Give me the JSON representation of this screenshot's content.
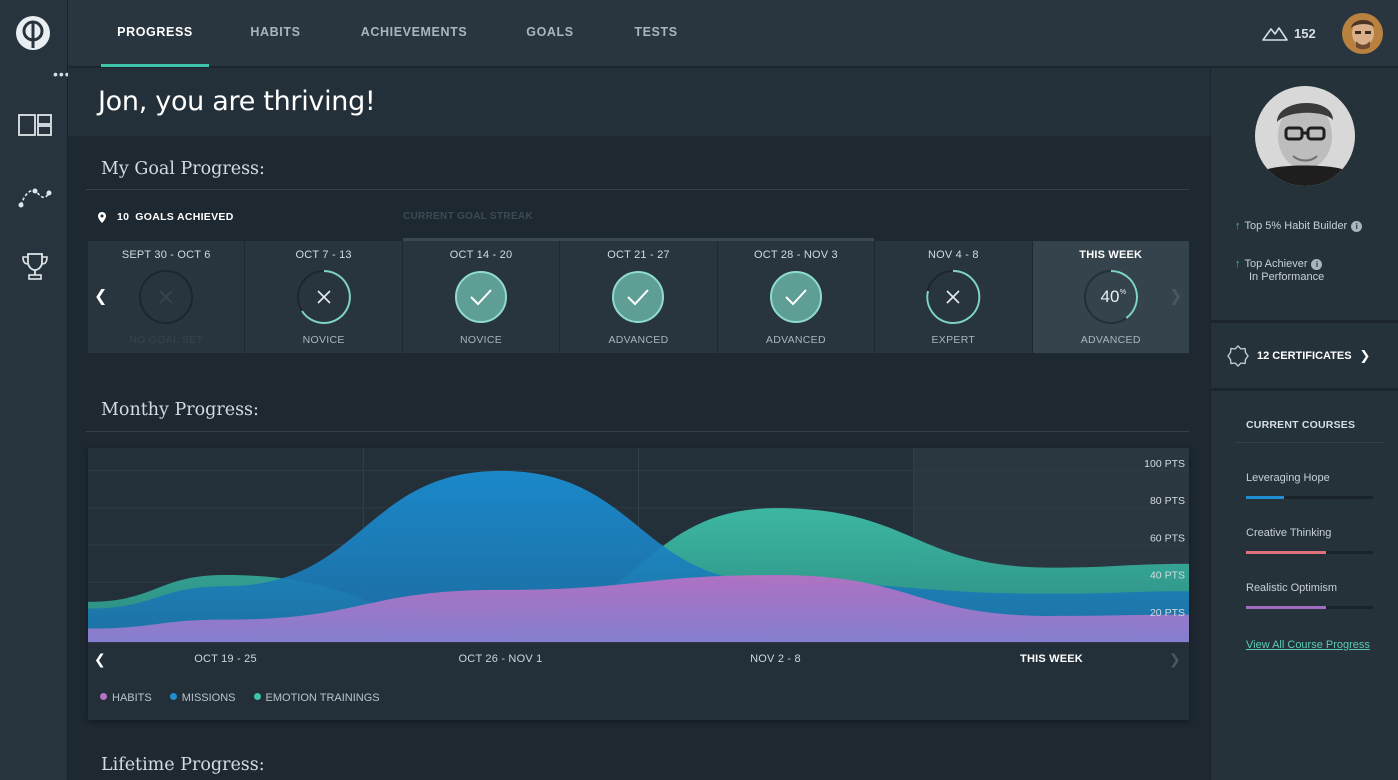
{
  "nav": {
    "tabs": [
      {
        "label": "PROGRESS",
        "active": true
      },
      {
        "label": "HABITS"
      },
      {
        "label": "ACHIEVEMENTS"
      },
      {
        "label": "GOALS"
      },
      {
        "label": "TESTS"
      }
    ],
    "points": "152",
    "points_icon": "mountain-icon",
    "more_icon": "more-dots-icon"
  },
  "rail": {
    "items": [
      {
        "icon": "dashboard-icon"
      },
      {
        "icon": "path-icon"
      },
      {
        "icon": "trophy-icon"
      }
    ]
  },
  "hero": {
    "greeting": "Jon, you are thriving!"
  },
  "goal_progress": {
    "title": "My Goal Progress:",
    "achieved_count": "10",
    "achieved_label": "GOALS ACHIEVED",
    "streak_label": "CURRENT GOAL STREAK",
    "weeks": [
      {
        "range": "SEPT 30 - OCT 6",
        "status": "none",
        "level": "NO GOAL SET"
      },
      {
        "range": "OCT 7 - 13",
        "status": "fail",
        "level": "NOVICE"
      },
      {
        "range": "OCT 14 - 20",
        "status": "done",
        "level": "NOVICE"
      },
      {
        "range": "OCT 21 - 27",
        "status": "done",
        "level": "ADVANCED"
      },
      {
        "range": "OCT 28 - NOV 3",
        "status": "done",
        "level": "ADVANCED"
      },
      {
        "range": "NOV 4 - 8",
        "status": "fail",
        "level": "EXPERT"
      },
      {
        "range": "THIS WEEK",
        "status": "progress",
        "percent": "40",
        "percent_sign": "%",
        "level": "ADVANCED"
      }
    ]
  },
  "monthly": {
    "title": "Monthy Progress:",
    "periods": [
      "OCT 19 - 25",
      "OCT 26 - NOV 1",
      "NOV 2 - 8",
      "THIS WEEK"
    ],
    "legend": [
      "HABITS",
      "MISSIONS",
      "EMOTION TRAININGS"
    ]
  },
  "chart_data": {
    "type": "area",
    "x": [
      "OCT 19 - 25",
      "OCT 26 - NOV 1",
      "NOV 2 - 8",
      "THIS WEEK"
    ],
    "y_ticks": [
      "100 PTS",
      "80 PTS",
      "60 PTS",
      "40 PTS",
      "20 PTS"
    ],
    "ylim": [
      0,
      100
    ],
    "series": [
      {
        "name": "HABITS",
        "color": "#a06cc0",
        "values": [
          12,
          28,
          36,
          14
        ]
      },
      {
        "name": "MISSIONS",
        "color": "#1f8fd0",
        "values": [
          30,
          92,
          32,
          26
        ]
      },
      {
        "name": "EMOTION TRAININGS",
        "color": "#3fc3aa",
        "values": [
          36,
          10,
          72,
          40
        ]
      }
    ]
  },
  "lifetime": {
    "title": "Lifetime Progress:"
  },
  "side": {
    "stats": [
      {
        "line1": "Top 5% Habit Builder",
        "line2": ""
      },
      {
        "line1": "Top Achiever",
        "line2": "In Performance"
      }
    ],
    "certificates": "12 CERTIFICATES",
    "courses_title": "CURRENT COURSES",
    "courses": [
      {
        "name": "Leveraging Hope",
        "progress": 0.3,
        "color": "#1f8fd0"
      },
      {
        "name": "Creative Thinking",
        "progress": 0.63,
        "color": "#e0707a"
      },
      {
        "name": "Realistic Optimism",
        "progress": 0.63,
        "color": "#a06cc0"
      }
    ],
    "view_all": "View All Course Progress"
  }
}
